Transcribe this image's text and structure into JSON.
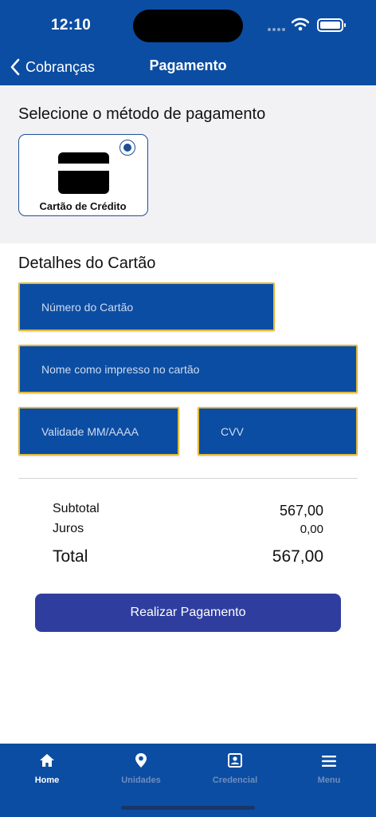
{
  "status_bar": {
    "time": "12:10"
  },
  "nav": {
    "back_label": "Cobranças",
    "title": "Pagamento"
  },
  "payment_method": {
    "title": "Selecione o método de pagamento",
    "options": [
      {
        "label": "Cartão de Crédito",
        "icon": "credit-card-icon",
        "selected": true
      }
    ]
  },
  "card_details": {
    "title": "Detalhes do Cartão",
    "fields": {
      "number": {
        "placeholder": "Número do Cartão",
        "value": ""
      },
      "name": {
        "placeholder": "Nome como impresso no cartão",
        "value": ""
      },
      "expiry": {
        "placeholder": "Validade MM/AAAA",
        "value": ""
      },
      "cvv": {
        "placeholder": "CVV",
        "value": ""
      }
    }
  },
  "summary": {
    "subtotal_label": "Subtotal",
    "subtotal_value": "567,00",
    "interest_label": "Juros",
    "interest_value": "0,00",
    "total_label": "Total",
    "total_value": "567,00"
  },
  "action": {
    "pay_label": "Realizar Pagamento"
  },
  "tabbar": {
    "items": [
      {
        "label": "Home",
        "icon": "home-icon",
        "active": true
      },
      {
        "label": "Unidades",
        "icon": "location-pin-icon",
        "active": false
      },
      {
        "label": "Credencial",
        "icon": "badge-icon",
        "active": false
      },
      {
        "label": "Menu",
        "icon": "hamburger-menu-icon",
        "active": false
      }
    ]
  },
  "colors": {
    "primary": "#0b4da2",
    "field_border": "#e2b93b",
    "button": "#2f3e9e",
    "section_bg": "#f2f2f4",
    "tab_inactive": "#6f8dbf"
  }
}
